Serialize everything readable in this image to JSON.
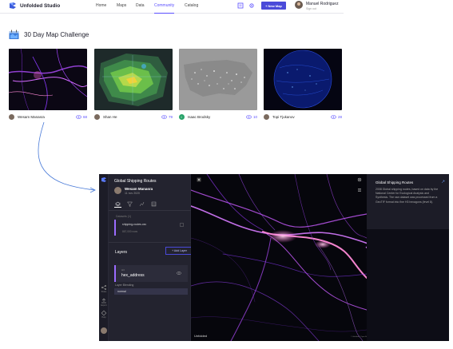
{
  "app": {
    "name": "Unfolded Studio"
  },
  "nav": {
    "items": [
      "Home",
      "Maps",
      "Data",
      "Community",
      "Catalog"
    ],
    "active": "Community"
  },
  "actions": {
    "new_map": "+ New Map"
  },
  "user": {
    "name": "Manuel Rodriguez",
    "sub": "Sign out"
  },
  "challenge": {
    "title": "30 Day Map Challenge"
  },
  "cards": [
    {
      "author": "Wesam Manasra",
      "views": "68"
    },
    {
      "author": "Shan He",
      "views": "79"
    },
    {
      "author": "Isaac Brodsky",
      "views": "10"
    },
    {
      "author": "Topi Tjukanov",
      "views": "28"
    }
  ],
  "map_app": {
    "title": "Global Shipping Routes",
    "author": "Wesam Manasra",
    "date": "11 nov 2020",
    "datasets_label": "Datasets (1)",
    "dataset_name": "shipping-routes.csv",
    "dataset_rows": "867,000 rows",
    "layers_title": "Layers",
    "add_layer": "+ Add Layer",
    "layer_type": "H3",
    "layer_name": "hex_address",
    "blend_label": "Layer Blending",
    "blend_value": "normal",
    "rail_labels": [
      "Share",
      "Export",
      "Help"
    ],
    "brand": "Unfolded",
    "mapbox": "mapbox",
    "attribution": "© Unfolded © Open StreetMap | Improve this map | © Mapbox",
    "legend_title": "Global Shipping Routes",
    "legend_text": "2008 Global shipping routes, based on data by the National Center for Ecological Analysis and Synthesis. The raw dataset was processed from a GeoTIF format into fine H3 hexagons (level 8)."
  },
  "colors": {
    "accent": "#5a4fff",
    "button": "#4a4ad9",
    "route": "#c85bff",
    "route_hot": "#ffb3d9"
  }
}
